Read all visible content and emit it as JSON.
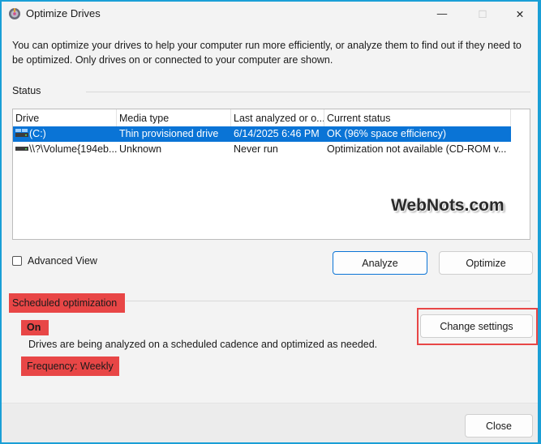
{
  "window": {
    "title": "Optimize Drives",
    "minimize_glyph": "—",
    "maximize_glyph": "☐",
    "close_glyph": "✕"
  },
  "description": "You can optimize your drives to help your computer run more efficiently, or analyze them to find out if they need to be optimized. Only drives on or connected to your computer are shown.",
  "status": {
    "label": "Status"
  },
  "table": {
    "headers": [
      "Drive",
      "Media type",
      "Last analyzed or o...",
      "Current status"
    ],
    "rows": [
      {
        "drive": "(C:)",
        "media": "Thin provisioned drive",
        "last": "6/14/2025 6:46 PM",
        "status": "OK (96% space efficiency)",
        "selected": true,
        "icon": "windows-drive-icon"
      },
      {
        "drive": "\\\\?\\Volume{194eb...",
        "media": "Unknown",
        "last": "Never run",
        "status": "Optimization not available (CD-ROM v...",
        "selected": false,
        "icon": "drive-icon"
      }
    ]
  },
  "advanced_view_label": "Advanced View",
  "buttons": {
    "analyze": "Analyze",
    "optimize": "Optimize",
    "change_settings": "Change settings",
    "close": "Close"
  },
  "scheduled": {
    "label": "Scheduled optimization",
    "state": "On",
    "description": "Drives are being analyzed on a scheduled cadence and optimized as needed.",
    "frequency": "Frequency: Weekly"
  },
  "watermark": "WebNots.com",
  "colors": {
    "accent": "#0a74d6",
    "highlight": "#e84646",
    "frame": "#1a9fd6"
  }
}
